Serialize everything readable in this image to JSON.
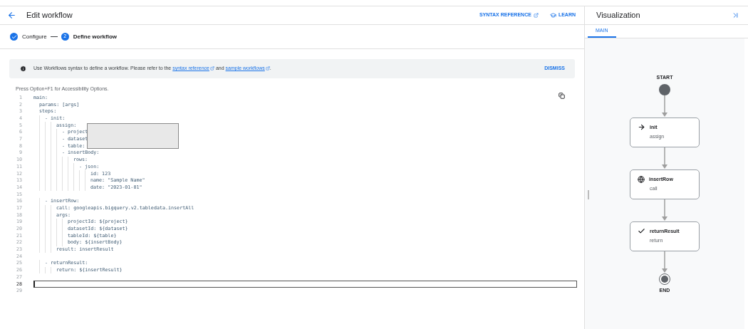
{
  "header": {
    "title": "Edit workflow",
    "links": [
      {
        "label": "SYNTAX REFERENCE",
        "kind": "external"
      },
      {
        "label": "LEARN",
        "kind": "learn"
      }
    ]
  },
  "stepper": [
    {
      "label": "Configure",
      "done": true,
      "selected": false
    },
    {
      "label": "Define workflow",
      "number": "2",
      "done": false,
      "selected": true
    }
  ],
  "banner": {
    "text_before": "Use Workflows syntax to define a workflow. Please refer to the",
    "link_1": "syntax reference",
    "text_middle": "and",
    "link_2": "sample workflows",
    "text_after": ".",
    "dismiss": "DISMISS"
  },
  "editor": {
    "hint": "Press Option+F1 for Accessibility Options.",
    "lines": [
      {
        "number": "1",
        "text": "main:",
        "current": false
      },
      {
        "number": "2",
        "text": "  params: [args]",
        "current": false
      },
      {
        "number": "3",
        "text": "  steps:",
        "current": false
      },
      {
        "number": "4",
        "text": "    - init:",
        "current": false
      },
      {
        "number": "5",
        "text": "        assign:",
        "current": false
      },
      {
        "number": "6",
        "text": "          - project",
        "current": false
      },
      {
        "number": "7",
        "text": "          - dataset",
        "current": false
      },
      {
        "number": "8",
        "text": "          - table:",
        "current": false
      },
      {
        "number": "9",
        "text": "          - insertBody:",
        "current": false
      },
      {
        "number": "10",
        "text": "              rows:",
        "current": false
      },
      {
        "number": "11",
        "text": "                - json:",
        "current": false
      },
      {
        "number": "12",
        "text": "                    id: 123",
        "current": false
      },
      {
        "number": "13",
        "text": "                    name: \"Sample Name\"",
        "current": false
      },
      {
        "number": "14",
        "text": "                    date: \"2023-01-01\"",
        "current": false
      },
      {
        "number": "15",
        "current": false
      },
      {
        "number": "16",
        "text": "    - insertRow:",
        "current": false
      },
      {
        "number": "17",
        "text": "        call: googleapis.bigquery.v2.tabledata.insertAll",
        "current": false
      },
      {
        "number": "18",
        "text": "        args:",
        "current": false
      },
      {
        "number": "19",
        "text": "            projectId: ${project}",
        "current": false
      },
      {
        "number": "20",
        "text": "            datasetId: ${dataset}",
        "current": false
      },
      {
        "number": "21",
        "text": "            tableId: ${table}",
        "current": false
      },
      {
        "number": "22",
        "text": "            body: ${insertBody}",
        "current": false
      },
      {
        "number": "23",
        "text": "        result: insertResult",
        "current": false
      },
      {
        "number": "24",
        "current": false
      },
      {
        "number": "25",
        "text": "    - returnResult:",
        "current": false
      },
      {
        "number": "26",
        "text": "        return: ${insertResult}",
        "current": false
      },
      {
        "number": "27",
        "current": false
      },
      {
        "number": "28",
        "current": true
      },
      {
        "number": "29",
        "current": false
      }
    ]
  },
  "visualization": {
    "title": "Visualization",
    "tabs": [
      {
        "label": "MAIN",
        "selected": true
      }
    ],
    "start": "START",
    "end": "END",
    "steps": [
      {
        "name": "init",
        "type": "assign",
        "kind": "assign"
      },
      {
        "name": "insertRow",
        "type": "call",
        "kind": "call"
      },
      {
        "name": "returnResult",
        "type": "return",
        "kind": "return"
      }
    ]
  }
}
